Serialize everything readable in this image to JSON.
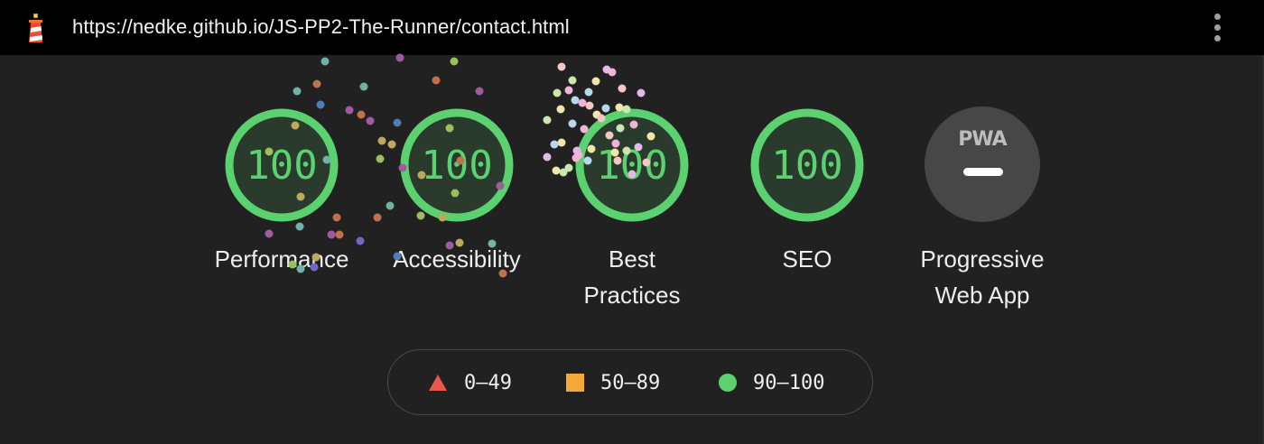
{
  "header": {
    "url": "https://nedke.github.io/JS-PP2-The-Runner/contact.html",
    "logo_icon": "lighthouse-icon",
    "menu_icon": "kebab-menu-icon"
  },
  "colors": {
    "pass": "#5bd170",
    "average": "#f4a83a",
    "fail": "#e9584a",
    "background": "#212121",
    "gauge_fill": "#2a3a2c",
    "pwa_badge": "#474747"
  },
  "gauges": [
    {
      "label": "Performance",
      "score": "100"
    },
    {
      "label": "Accessibility",
      "score": "100"
    },
    {
      "label_line1": "Best",
      "label_line2": "Practices",
      "score": "100"
    },
    {
      "label": "SEO",
      "score": "100"
    }
  ],
  "pwa": {
    "badge_text": "PWA",
    "label_line1": "Progressive",
    "label_line2": "Web App"
  },
  "legend": [
    {
      "icon": "triangle-icon",
      "range": "0–49"
    },
    {
      "icon": "square-icon",
      "range": "50–89"
    },
    {
      "icon": "circle-icon",
      "range": "90–100"
    }
  ]
}
